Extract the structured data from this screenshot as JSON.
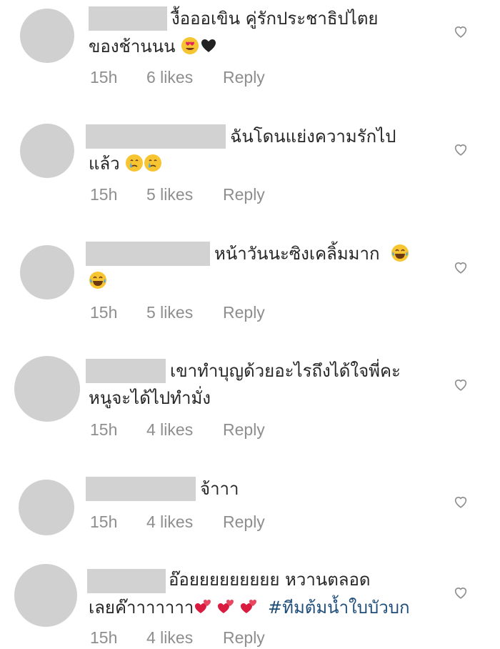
{
  "comments": [
    {
      "line1": "งื้อออเขิน คู่รักประชาธิปไตย",
      "line2": "ของช้านนน",
      "time": "15h",
      "likes": "6 likes",
      "reply": "Reply",
      "emoji_icons": [
        "heart-eyes-emoji",
        "black-heart-emoji"
      ]
    },
    {
      "line1": "ฉันโดนแย่งความรักไป",
      "line2": "แล้ว",
      "time": "15h",
      "likes": "5 likes",
      "reply": "Reply",
      "emoji_icons": [
        "crying-face-emoji",
        "crying-face-emoji"
      ]
    },
    {
      "line1": "หน้าวันนะซิงเคลิ้มมาก",
      "line2": "",
      "time": "15h",
      "likes": "5 likes",
      "reply": "Reply",
      "emoji_icons": [
        "tears-of-joy-emoji",
        "tears-of-joy-emoji"
      ]
    },
    {
      "line1": "เขาทำบุญด้วยอะไรถึงได้ใจพี่คะ",
      "line2": "หนูจะได้ไปทำมั่ง",
      "time": "15h",
      "likes": "4 likes",
      "reply": "Reply",
      "emoji_icons": []
    },
    {
      "line1": "จ้าาา",
      "line2": "",
      "time": "15h",
      "likes": "4 likes",
      "reply": "Reply",
      "emoji_icons": []
    },
    {
      "line1": "อ๊อยยยยยยยยย หวานตลอด",
      "line2": "เลยค๊าาาาาาา",
      "hashtag": "#ทีมต้มน้ำใบบัวบก",
      "time": "15h",
      "likes": "4 likes",
      "reply": "Reply",
      "emoji_icons": [
        "two-hearts-emoji",
        "two-hearts-emoji",
        "two-hearts-emoji"
      ]
    }
  ],
  "icons": {
    "like": "heart-outline-icon"
  },
  "colors": {
    "text": "#262626",
    "meta": "#8e8e8e",
    "hashtag": "#1f4d7a",
    "placeholder": "#d2d2d2"
  }
}
